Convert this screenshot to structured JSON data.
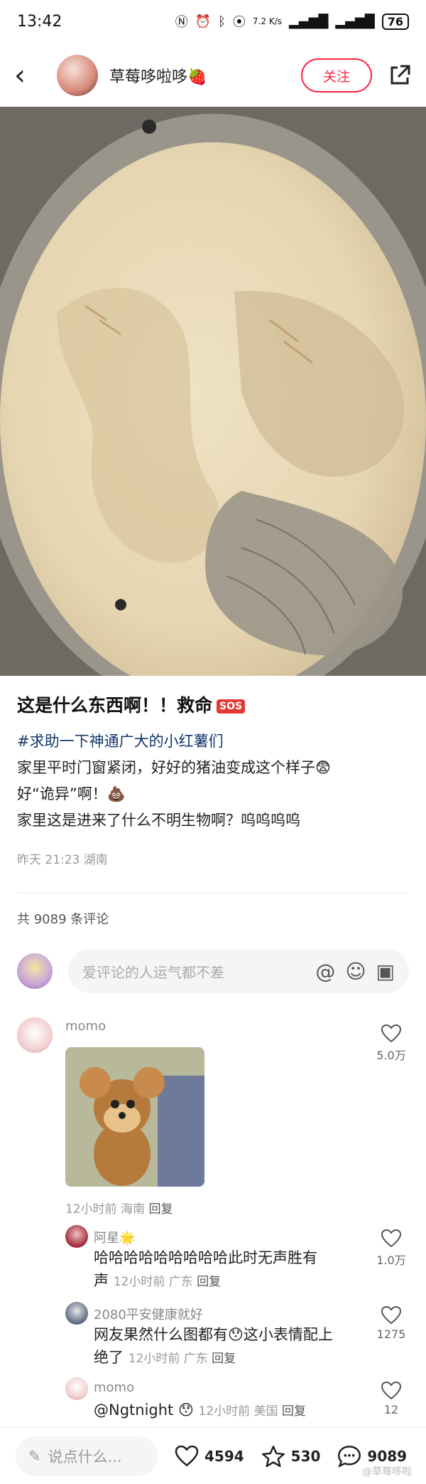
{
  "status": {
    "time": "13:42",
    "speed": "7.2 K/s",
    "battery": "76"
  },
  "header": {
    "username": "草莓哆啦哆🍓",
    "follow_label": "关注"
  },
  "post": {
    "title": "这是什么东西啊！！救命",
    "title_badge": "SOS",
    "lines": [
      {
        "text": "#求助一下神通广大的小红薯们",
        "hashtag": true
      },
      {
        "text": "家里平时门窗紧闭，好好的猪油变成这个样子😨",
        "hashtag": false
      },
      {
        "text": "好“诡异”啊！💩",
        "hashtag": false
      },
      {
        "text": "家里这是进来了什么不明生物啊？呜呜呜呜",
        "hashtag": false
      }
    ],
    "meta": "昨天 21:23 湖南"
  },
  "comments_summary": {
    "count_label": "共 9089 条评论",
    "input_placeholder": "爱评论的人运气都不差"
  },
  "comments": [
    {
      "name": "momo",
      "time_loc": "12小时前  海南",
      "reply": "回复",
      "likes": "5.0万"
    },
    {
      "name": "阿星🌟",
      "text_line1": "哈哈哈哈哈哈哈哈哈此时无声胜有",
      "text_line2": "声",
      "time_loc": "12小时前  广东",
      "reply": "回复",
      "likes": "1.0万"
    },
    {
      "name": "2080平安健康就好",
      "text_line1": "网友果然什么图都有😯这小表情配上",
      "text_line2": "绝了",
      "time_loc": "12小时前  广东",
      "reply": "回复",
      "likes": "1275"
    },
    {
      "name": "momo",
      "text_line1": "@Ngtnight 😯",
      "time_loc": "12小时前  美国",
      "reply": "回复",
      "likes": "12"
    }
  ],
  "bottom": {
    "say_placeholder": "说点什么...",
    "likes": "4594",
    "collects": "530",
    "comments": "9089"
  },
  "watermark": "@草莓哆啦"
}
